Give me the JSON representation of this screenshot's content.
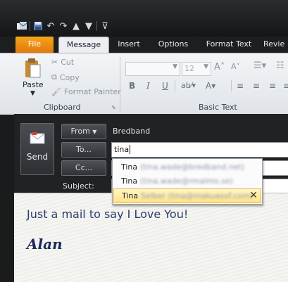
{
  "tabs": {
    "file": "File",
    "message": "Message",
    "insert": "Insert",
    "options": "Options",
    "format_text": "Format Text",
    "review": "Revie"
  },
  "ribbon": {
    "clipboard": {
      "paste": "Paste",
      "cut": "Cut",
      "copy": "Copy",
      "format_painter": "Format Painter",
      "group_label": "Clipboard"
    },
    "basic_text": {
      "font_size": "12",
      "group_label": "Basic Text"
    }
  },
  "compose": {
    "send": "Send",
    "from_button": "From",
    "from_value": "Bredband",
    "to_button": "To...",
    "to_value": "tina",
    "cc_button": "Cc...",
    "subject_label": "Subject:"
  },
  "autocomplete": [
    {
      "name": "Tina",
      "address": "(tina.wade@bredband.net)"
    },
    {
      "name": "Tina",
      "address": "(tina.wade@rmalmo.se)"
    },
    {
      "name": "Tina",
      "address": "Selber (tina@makuasof.com)",
      "selected": true
    }
  ],
  "body": {
    "message": "Just a mail to say I Love You!",
    "signature": "Alan"
  },
  "colors": {
    "file_tab": "#f0900f",
    "accent_blue": "#2a3b6c",
    "selection": "#ffe38a"
  }
}
